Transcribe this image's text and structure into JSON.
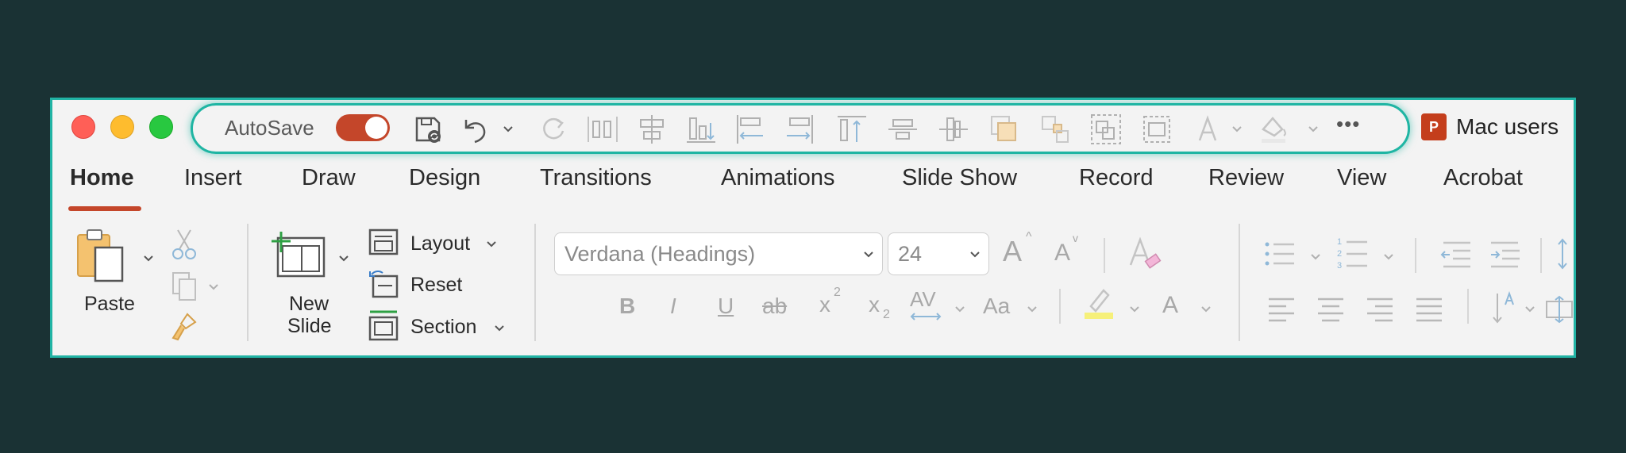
{
  "quick_access": {
    "autosave_label": "AutoSave",
    "autosave_on": true,
    "more_label": "•••"
  },
  "document": {
    "app_badge": "P",
    "title": "Mac users"
  },
  "tabs": [
    "Home",
    "Insert",
    "Draw",
    "Design",
    "Transitions",
    "Animations",
    "Slide Show",
    "Record",
    "Review",
    "View",
    "Acrobat"
  ],
  "ribbon": {
    "paste_label": "Paste",
    "new_slide_line1": "New",
    "new_slide_line2": "Slide",
    "layout_label": "Layout",
    "reset_label": "Reset",
    "section_label": "Section",
    "font_name": "Verdana (Headings)",
    "font_size": "24",
    "bold": "B",
    "italic": "I",
    "underline": "U",
    "strike": "ab",
    "superscript": "x",
    "superscript_mark": "2",
    "subscript": "x",
    "subscript_mark": "2",
    "spacing": "AV",
    "change_case": "Aa",
    "font_color": "A",
    "grow": "A",
    "shrink": "A"
  },
  "colors": {
    "accent": "#c4462a",
    "highlight": "#f6f07a",
    "frame": "#21b3a4",
    "background": "#1a3234"
  }
}
